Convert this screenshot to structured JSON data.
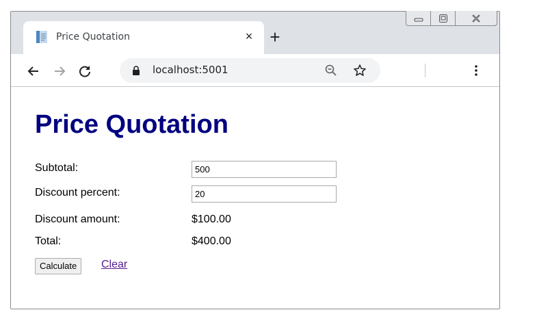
{
  "browser": {
    "tab_title": "Price Quotation",
    "tab_close": "×",
    "new_tab": "+",
    "url": "localhost:5001"
  },
  "page": {
    "title": "Price Quotation",
    "fields": {
      "subtotal_label": "Subtotal:",
      "subtotal_value": "500",
      "discount_percent_label": "Discount percent:",
      "discount_percent_value": "20",
      "discount_amount_label": "Discount amount:",
      "discount_amount_value": "$100.00",
      "total_label": "Total:",
      "total_value": "$400.00"
    },
    "calculate_label": "Calculate",
    "clear_label": "Clear"
  },
  "colors": {
    "title": "#000080",
    "visited_link": "#551a8b",
    "tabstrip": "#dee1e6",
    "omnibox": "#f1f3f4"
  },
  "icons": [
    "document-favicon-icon",
    "close-icon",
    "plus-icon",
    "minimize-icon",
    "restore-icon",
    "window-close-icon",
    "back-arrow-icon",
    "forward-arrow-icon",
    "reload-icon",
    "lock-icon",
    "zoom-out-icon",
    "star-icon",
    "kebab-menu-icon"
  ]
}
